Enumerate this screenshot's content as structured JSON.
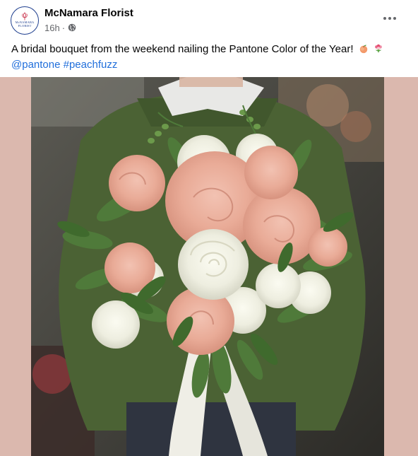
{
  "post": {
    "page_name": "McNamara Florist",
    "time": "16h",
    "separator": "·",
    "avatar_text_line1": "McNAMARA",
    "avatar_text_line2": "FLORIST",
    "caption": "A bridal bouquet from the weekend nailing the Pantone Color of the Year!",
    "caption_emojis": [
      "peach-emoji",
      "bouquet-emoji"
    ],
    "hashtags": [
      {
        "label": "@pantone"
      },
      {
        "label": "#peachfuzz"
      }
    ]
  },
  "colors": {
    "link": "#216fdb",
    "secondary_text": "#65676b",
    "frame_background": "#dbb8ae",
    "brand": "#1f3f8f"
  },
  "icons": {
    "visibility": "globe-icon",
    "menu": "more-options-icon"
  }
}
